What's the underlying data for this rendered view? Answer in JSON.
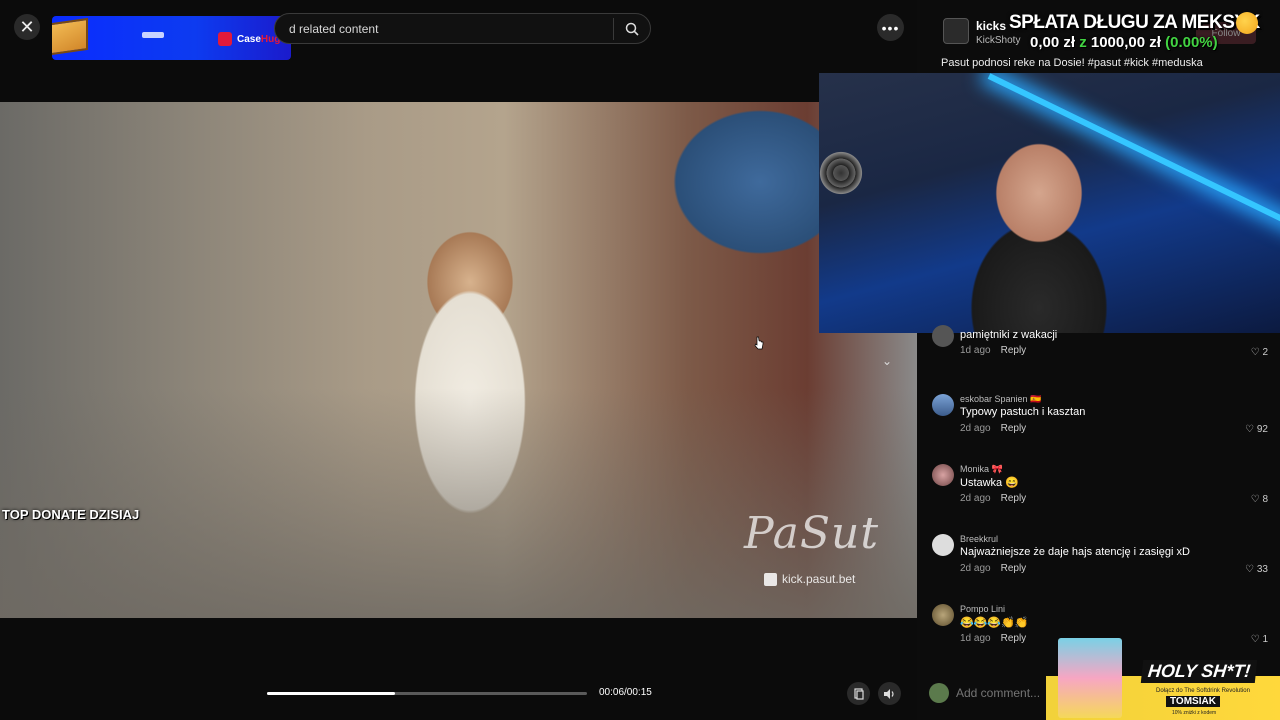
{
  "topbar": {
    "close_label": "✕",
    "sponsor": {
      "brand_a": "Case",
      "brand_b": "Hug"
    },
    "search_text": "d related content",
    "more_label": "•••"
  },
  "video": {
    "overlay_top_donate": "TOP DONATE DZISIAJ",
    "watermark_logo": "PaSut",
    "watermark_handle": "kick.pasut.bet"
  },
  "controls": {
    "time": "00:06/00:15",
    "progress_fraction": 0.4
  },
  "channel": {
    "name": "kicks",
    "sub": "KickShoty",
    "follow_label": "Follow"
  },
  "overlay_debt": {
    "title": "SPŁATA DŁUGU ZA MEKSYK",
    "current": "0,00 zł",
    "sep": "z",
    "goal": "1000,00 zł",
    "percent": "(0.00%)"
  },
  "video_title": "Pasut podnosi reke na Dosie! #pasut #kick #meduska",
  "comments": [
    {
      "author": "",
      "text": "pamiętniki z wakacji",
      "time": "1d ago",
      "reply": "Reply",
      "likes": "2"
    },
    {
      "author": "eskobar Spanien 🇪🇸",
      "text": "Typowy pastuch i kasztan",
      "time": "2d ago",
      "reply": "Reply",
      "likes": "92"
    },
    {
      "author": "Monika 🎀",
      "text": "Ustawka 😄",
      "time": "2d ago",
      "reply": "Reply",
      "likes": "8"
    },
    {
      "author": "Breekkrul",
      "text": "Najważniejsze że daje hajs atencję i zasięgi xD",
      "time": "2d ago",
      "reply": "Reply",
      "likes": "33"
    },
    {
      "author": "Pompo Lini",
      "text": "😂😂😂👏👏",
      "time": "1d ago",
      "reply": "Reply",
      "likes": "1"
    }
  ],
  "add_comment": {
    "placeholder": "Add comment..."
  },
  "holy_banner": {
    "headline": "HOLY SH*T!",
    "sub": "Dołącz do The Softdrink Revolution",
    "name": "TOMSIAK",
    "tag": "10% zniżki z kodem"
  },
  "icons": {
    "heart": "♡",
    "chevron_down": "⌄"
  }
}
